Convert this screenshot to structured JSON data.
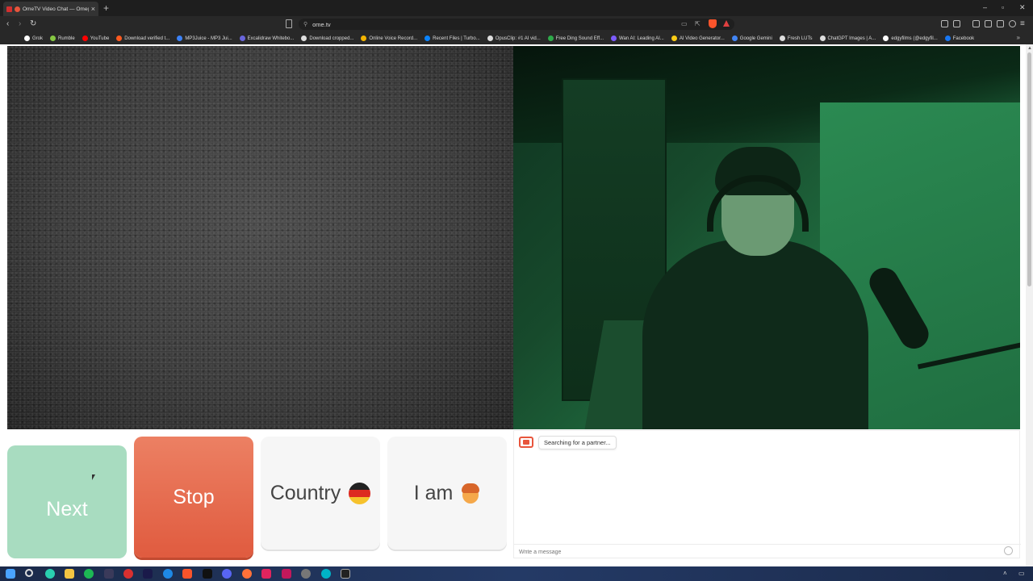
{
  "browser": {
    "tab_title": "OmeTV Video Chat — Omeg",
    "new_tab": "+",
    "url": "ome.tv",
    "window_controls": [
      "–",
      "▫",
      "✕"
    ],
    "bookmarks": [
      {
        "label": "Grok",
        "color": "#ffffff"
      },
      {
        "label": "Rumble",
        "color": "#85c742"
      },
      {
        "label": "YouTube",
        "color": "#ff0000"
      },
      {
        "label": "Download verified t...",
        "color": "#ff5a1f"
      },
      {
        "label": "MP3Juice - MP3 Jui...",
        "color": "#3b82f6"
      },
      {
        "label": "Excalidraw Whitebo...",
        "color": "#6965db"
      },
      {
        "label": "Download cropped...",
        "color": "#dddddd"
      },
      {
        "label": "Online Voice Record...",
        "color": "#f4b400"
      },
      {
        "label": "Recent Files | Turbo...",
        "color": "#0a84ff"
      },
      {
        "label": "OpusClip: #1 AI vid...",
        "color": "#dddddd"
      },
      {
        "label": "Free Ding Sound Eff...",
        "color": "#2eaa4a"
      },
      {
        "label": "Wan AI: Leading AI...",
        "color": "#7c5cff"
      },
      {
        "label": "AI Video Generator...",
        "color": "#facc15"
      },
      {
        "label": "Google Gemini",
        "color": "#4285f4"
      },
      {
        "label": "Fresh LUTs",
        "color": "#dddddd"
      },
      {
        "label": "ChatGPT Images | A...",
        "color": "#dddddd"
      },
      {
        "label": "edgyfilms (@edgyfil...",
        "color": "#ffffff"
      },
      {
        "label": "Facebook",
        "color": "#1877f2"
      }
    ]
  },
  "controls": {
    "next_label": "Next",
    "stop_label": "Stop",
    "country_label": "Country",
    "iam_label": "I am"
  },
  "chat": {
    "status_message": "Searching for a partner...",
    "input_placeholder": "Write a message"
  },
  "colors": {
    "next": "#a8dcc0",
    "stop": "#e05b3f",
    "brand": "#e8553c"
  }
}
